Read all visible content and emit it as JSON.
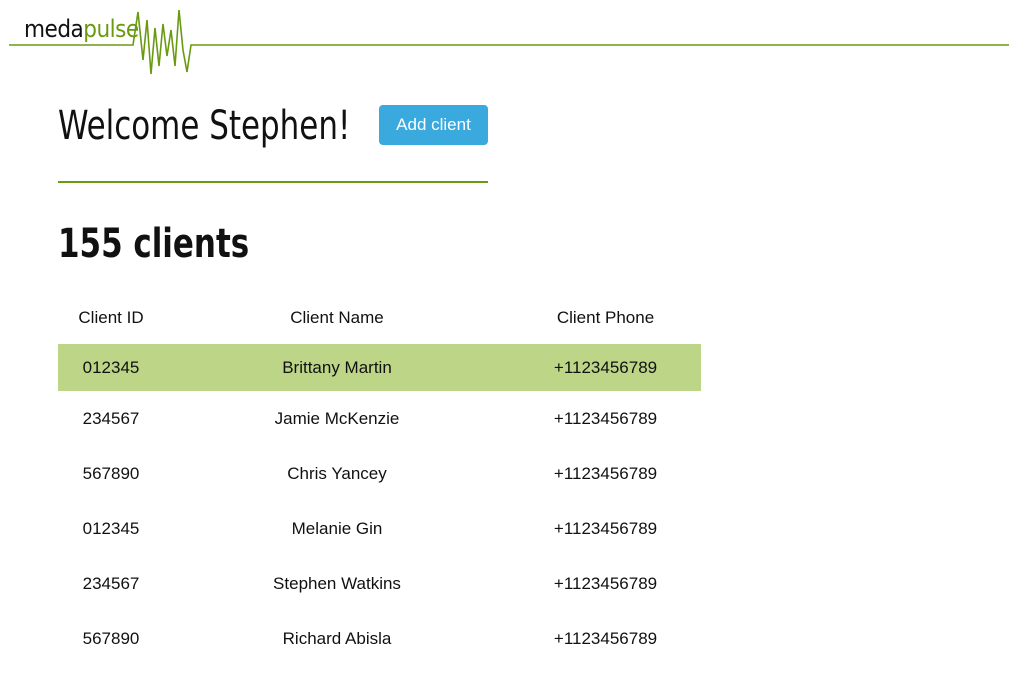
{
  "brand": {
    "name_part1": "meda",
    "name_part2": "pulse",
    "accent_color": "#6a9a12"
  },
  "welcome": {
    "title": "Welcome Stephen!",
    "add_button_label": "Add client",
    "button_color": "#3aa9de"
  },
  "clients": {
    "count_label": "155 clients",
    "columns": [
      "Client ID",
      "Client Name",
      "Client Phone"
    ],
    "selected_row_color": "#bdd586",
    "rows": [
      {
        "id": "012345",
        "name": "Brittany Martin",
        "phone": "+1123456789",
        "selected": true
      },
      {
        "id": "234567",
        "name": "Jamie McKenzie",
        "phone": "+1123456789",
        "selected": false
      },
      {
        "id": "567890",
        "name": "Chris Yancey",
        "phone": "+1123456789",
        "selected": false
      },
      {
        "id": "012345",
        "name": "Melanie Gin",
        "phone": "+1123456789",
        "selected": false
      },
      {
        "id": "234567",
        "name": "Stephen Watkins",
        "phone": "+1123456789",
        "selected": false
      },
      {
        "id": "567890",
        "name": "Richard Abisla",
        "phone": "+1123456789",
        "selected": false
      }
    ]
  }
}
